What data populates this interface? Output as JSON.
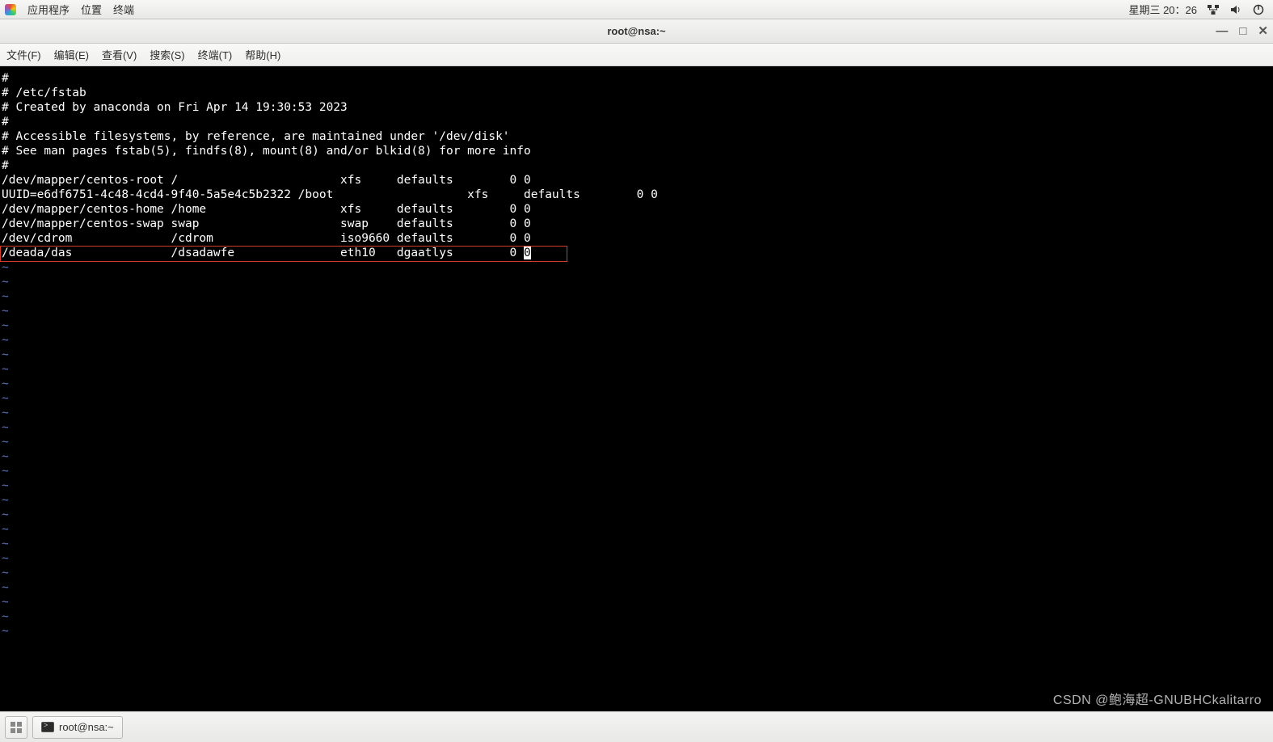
{
  "sysbar": {
    "apps": "应用程序",
    "places": "位置",
    "terminal": "终端",
    "daytime": "星期三 20：26"
  },
  "window": {
    "title": "root@nsa:~"
  },
  "menubar": {
    "file": "文件(F)",
    "edit": "编辑(E)",
    "view": "查看(V)",
    "search": "搜索(S)",
    "terminal": "终端(T)",
    "help": "帮助(H)"
  },
  "terminal": {
    "lines": [
      "#",
      "# /etc/fstab",
      "# Created by anaconda on Fri Apr 14 19:30:53 2023",
      "#",
      "# Accessible filesystems, by reference, are maintained under '/dev/disk'",
      "# See man pages fstab(5), findfs(8), mount(8) and/or blkid(8) for more info",
      "#",
      "/dev/mapper/centos-root /                       xfs     defaults        0 0",
      "UUID=e6df6751-4c48-4cd4-9f40-5a5e4c5b2322 /boot                   xfs     defaults        0 0",
      "/dev/mapper/centos-home /home                   xfs     defaults        0 0",
      "/dev/mapper/centos-swap swap                    swap    defaults        0 0",
      "/dev/cdrom              /cdrom                  iso9660 defaults        0 0",
      "/deada/das              /dsadawfe               eth10   dgaatlys        0 0"
    ],
    "tilde": "~"
  },
  "taskbar": {
    "item": "root@nsa:~"
  },
  "watermark": "CSDN @鲍海超-GNUBHCkalitarro"
}
